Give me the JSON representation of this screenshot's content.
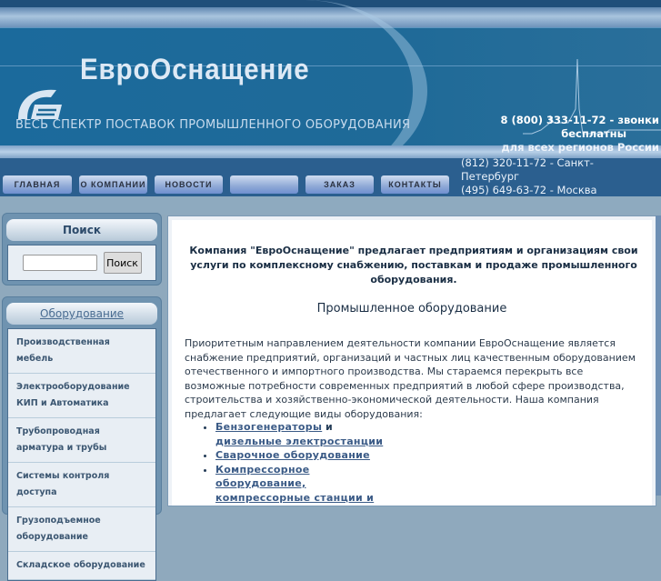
{
  "header": {
    "brand": "ЕвроОснащение",
    "tagline": "ВЕСЬ СПЕКТР ПОСТАВОК ПРОМЫШЛЕННОГО ОБОРУДОВАНИЯ",
    "phone_free": "8 (800) 333-11-72 - звонки",
    "phone_free_2": "бесплатны",
    "phone_free_3": "для всех регионов России",
    "phone_spb": "(812) 320-11-72 - Санкт-Петербург",
    "phone_msk": "(495) 649-63-72 - Москва"
  },
  "nav": [
    "ГЛАВНАЯ",
    "О КОМПАНИИ",
    "НОВОСТИ",
    "",
    "ЗАКАЗ",
    "КОНТАКТЫ"
  ],
  "search": {
    "title": "Поиск",
    "button": "Поиск",
    "value": ""
  },
  "equipment": {
    "title": "Оборудование",
    "items": [
      "Производственная мебель",
      "Электрооборудование КИП и Автоматика",
      "Трубопроводная арматура и трубы",
      "Системы контроля доступа",
      "Грузоподъемное оборудование",
      "Складское оборудование"
    ]
  },
  "main": {
    "intro": "Компания \"ЕвроОснащение\" предлагает предприятиям и организациям свои услуги по комплексному снабжению, поставкам и продаже промышленного оборудования.",
    "title": "Промышленное оборудование",
    "paragraph": "Приоритетным направлением деятельности  компании  ЕвроОснащение является снабжение предприятий, организаций и частных лиц качественным оборудованием отечественного и импортного производства. Мы стараемся перекрыть все возможные потребности современных предприятий в любой сфере производства, строительства и хозяйственно-экономической деятельности. Наша компания предлагает следующие виды оборудования:",
    "links": {
      "l1": "Бензогенераторы",
      "and": " и",
      "l1b": "дизельные электростанции",
      "l2": "Сварочное оборудование",
      "l3": "Компрессорное оборудование, компрессорные станции и"
    }
  }
}
